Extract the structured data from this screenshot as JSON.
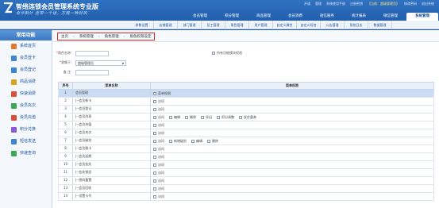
{
  "colors": {
    "header": "#1c56a3",
    "accent": "#e0262d",
    "selected_row": "#c9dcf3"
  },
  "app": {
    "title": "智络连锁会员管理系统专业版",
    "slogan": "合作制计 连带一个话，方程一种好风"
  },
  "header_links": [
    "开通",
    "管理",
    "系统使用手册",
    "注册密钥",
    "修改密码",
    "退出系统"
  ],
  "header_user": "【当前：超级管理员】",
  "top_tabs": [
    {
      "label": "会员管理"
    },
    {
      "label": "积分管理"
    },
    {
      "label": "商品管理"
    },
    {
      "label": "会员消费"
    },
    {
      "label": "短信服务"
    },
    {
      "label": "统计报表"
    },
    {
      "label": "微信管理"
    },
    {
      "label": "系统管理",
      "active": true
    }
  ],
  "sub_menu": [
    "参数设置",
    "店铺管理",
    "部门管理",
    "员工管理",
    "角色管理",
    "用户管理",
    "自定义属性",
    "自定义短信",
    "公告管理",
    "系统日志",
    "数据管理"
  ],
  "sidebar": {
    "title": "常用功能",
    "items": [
      {
        "label": "系统首页",
        "icon": "home-icon",
        "color": "#e07a2e"
      },
      {
        "label": "会员登卡",
        "icon": "user-add-icon",
        "color": "#3a85d4"
      },
      {
        "label": "会员登记",
        "icon": "user-icon",
        "color": "#3a85d4"
      },
      {
        "label": "商品消费",
        "icon": "cart-icon",
        "color": "#d9a520"
      },
      {
        "label": "快速消费",
        "icon": "fast-pay-icon",
        "color": "#d9503a"
      },
      {
        "label": "会员充次",
        "icon": "recharge-icon",
        "color": "#3aa852"
      },
      {
        "label": "会员充值",
        "icon": "wallet-icon",
        "color": "#d9503a"
      },
      {
        "label": "积分兑换",
        "icon": "gift-icon",
        "color": "#8a5ad4"
      },
      {
        "label": "短信发送",
        "icon": "sms-icon",
        "color": "#3a85d4"
      },
      {
        "label": "快速查询",
        "icon": "search-icon",
        "color": "#3aa852"
      }
    ]
  },
  "breadcrumb": [
    "主页",
    "系统管理",
    "角色管理",
    "角色权限设定"
  ],
  "form": {
    "role_name_label": "角色名称：",
    "role_name_value": "",
    "role_group_label": "隶属于：",
    "role_group_value": "超级管理员",
    "code_label": "备   注：",
    "code_value": "",
    "all_perms_label": "所有功能模块权限"
  },
  "table": {
    "headers": [
      "序号",
      "菜单名称",
      "菜单权限"
    ],
    "rows": [
      {
        "no": "1",
        "name": "会员管理",
        "perms": [
          "菜单权限"
        ],
        "selected": true
      },
      {
        "no": "2",
        "name": "|--会员新卡",
        "perms": [
          "访问"
        ]
      },
      {
        "no": "3",
        "name": "|--会员登记",
        "perms": [
          "访问"
        ]
      },
      {
        "no": "4",
        "name": "|--会员列表",
        "perms": [
          "访问",
          "编辑",
          "删除",
          "导出",
          "积分调整",
          "发优惠券"
        ]
      },
      {
        "no": "5",
        "name": "|--会员充值",
        "perms": [
          "访问"
        ]
      },
      {
        "no": "6",
        "name": "|--会员充次",
        "perms": [
          "访问"
        ]
      },
      {
        "no": "7",
        "name": "|--会员级别",
        "perms": [
          "访问",
          "新增级别",
          "编辑",
          "删除"
        ]
      },
      {
        "no": "8",
        "name": "|--会员换卡",
        "perms": [
          "访问"
        ]
      },
      {
        "no": "9",
        "name": "|--会员延期",
        "perms": [
          "访问"
        ]
      },
      {
        "no": "10",
        "name": "|--会员挂失",
        "perms": [
          "访问"
        ]
      },
      {
        "no": "11",
        "name": "|--挂失锁定",
        "perms": [
          "访问"
        ]
      },
      {
        "no": "12",
        "name": "|--密码重置",
        "perms": [
          "访问"
        ]
      },
      {
        "no": "13",
        "name": "|--会员回收",
        "perms": [
          "访问"
        ]
      },
      {
        "no": "14",
        "name": "|--设置卡号",
        "perms": [
          "访问"
        ]
      }
    ]
  }
}
